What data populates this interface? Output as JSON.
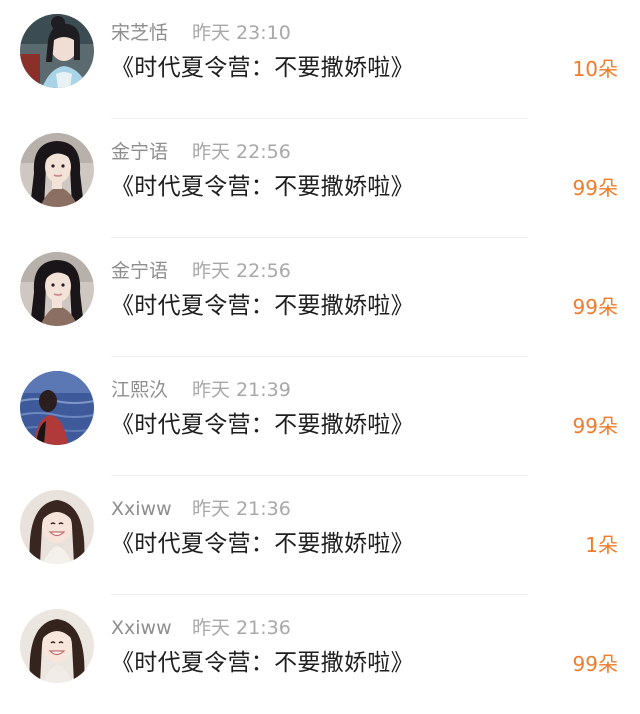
{
  "rows": [
    {
      "name": "宋芝恬",
      "time": "昨天 23:10",
      "title": "《时代夏令营：不要撒娇啦》",
      "count": "10朵",
      "avatar": "girl-with-bun-icon"
    },
    {
      "name": "金宁语",
      "time": "昨天 22:56",
      "title": "《时代夏令营：不要撒娇啦》",
      "count": "99朵",
      "avatar": "girl-portrait-icon"
    },
    {
      "name": "金宁语",
      "time": "昨天 22:56",
      "title": "《时代夏令营：不要撒娇啦》",
      "count": "99朵",
      "avatar": "girl-portrait-icon"
    },
    {
      "name": "江熙汣",
      "time": "昨天 21:39",
      "title": "《时代夏令营：不要撒娇啦》",
      "count": "99朵",
      "avatar": "boy-by-sea-icon"
    },
    {
      "name": "Xxiww",
      "time": "昨天 21:36",
      "title": "《时代夏令营：不要撒娇啦》",
      "count": "1朵",
      "avatar": "smiling-girl-icon"
    },
    {
      "name": "Xxiww",
      "time": "昨天 21:36",
      "title": "《时代夏令营：不要撒娇啦》",
      "count": "99朵",
      "avatar": "smiling-girl-icon"
    }
  ],
  "colors": {
    "count": "#f07b2b",
    "name": "#8e8e8e",
    "time": "#a8a8a8",
    "title": "#1e1e1e",
    "divider": "#efefef"
  }
}
